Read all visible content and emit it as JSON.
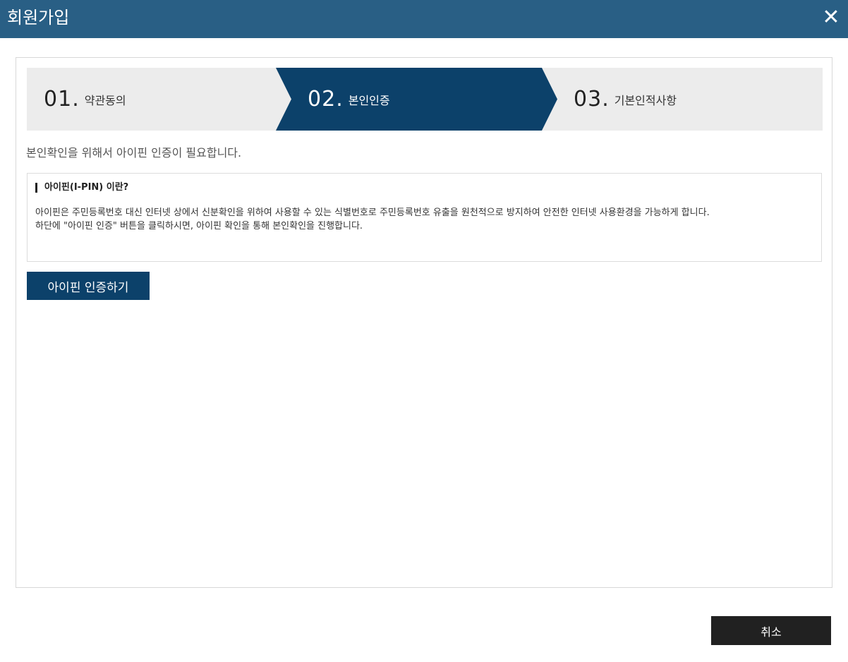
{
  "window": {
    "title": "회원가입",
    "close_symbol": "✕",
    "close_icon": "close-icon"
  },
  "steps": [
    {
      "number": "01",
      "dot": ".",
      "label": "약관동의",
      "active": false
    },
    {
      "number": "02",
      "dot": ".",
      "label": "본인인증",
      "active": true
    },
    {
      "number": "03",
      "dot": ".",
      "label": "기본인적사항",
      "active": false
    }
  ],
  "main": {
    "description": "본인확인을 위해서 아이핀 인증이 필요합니다.",
    "info": {
      "heading": "아이핀(I-PIN) 이란?",
      "paragraph1": "아이핀은 주민등록번호 대신 인터넷 상에서 신분확인을 위하여 사용할 수 있는 식별번호로 주민등록번호 유출을 원천적으로 방지하여 안전한 인터넷 사용환경을 가능하게 합니다.",
      "paragraph2": "하단에 \"아이핀 인증\" 버튼을 클릭하시면, 아이핀 확인을 통해 본인확인을 진행합니다."
    },
    "ipin_button_label": "아이핀 인증하기"
  },
  "footer": {
    "cancel_label": "취소"
  },
  "colors": {
    "titlebar": "#295f85",
    "active_step": "#0c416a",
    "step_bg": "#ececec",
    "cancel_button": "#212121"
  }
}
